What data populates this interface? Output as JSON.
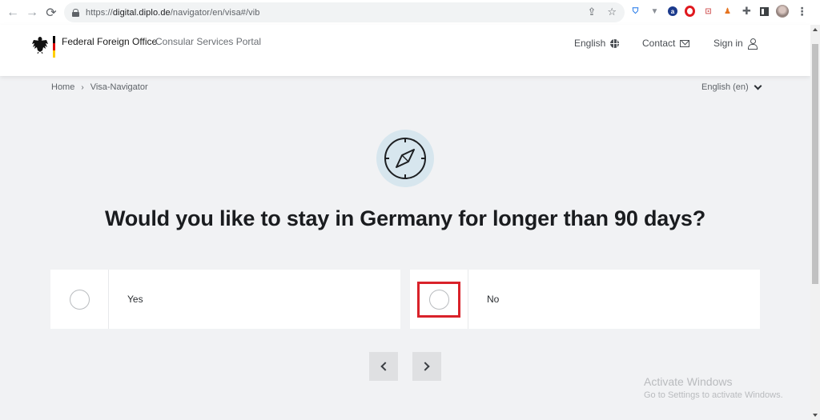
{
  "browser": {
    "url_prefix": "https://",
    "url_domain": "digital.diplo.de",
    "url_path": "/navigator/en/visa#/vib",
    "nav": {
      "back": "←",
      "forward": "→",
      "reload": "⟳"
    },
    "omni_icons": {
      "share": "⇪",
      "bookmark": "☆"
    },
    "extensions": [
      "shield-extension",
      "v-extension",
      "dot-extension",
      "opera-extension",
      "scan-extension",
      "fox-extension",
      "extensions-puzzle",
      "side-panel",
      "profile-avatar",
      "menu"
    ],
    "ext_glyphs": {
      "shield": "⛉",
      "v": "▼",
      "dot": "a",
      "scan": "⊡",
      "fox": "♟",
      "puzzle": "✚",
      "menu": "⋮"
    }
  },
  "header": {
    "brand": "Federal Foreign Office",
    "portal": "Consular Services Portal",
    "links": {
      "english": "English",
      "contact": "Contact",
      "signin": "Sign in"
    }
  },
  "breadcrumb": {
    "items": [
      "Home",
      "Visa-Navigator"
    ],
    "separator": "›"
  },
  "language_select": {
    "value": "English (en)"
  },
  "main": {
    "question": "Would you like to stay in Germany for longer than 90 days?",
    "options": [
      {
        "label": "Yes",
        "selected": false
      },
      {
        "label": "No",
        "selected": false,
        "highlighted": true
      }
    ]
  },
  "colors": {
    "highlight": "#d9222a",
    "compass_bg": "#d7e6ee",
    "page_bg": "#f1f2f4"
  },
  "watermark": {
    "title": "Activate Windows",
    "subtitle": "Go to Settings to activate Windows."
  }
}
